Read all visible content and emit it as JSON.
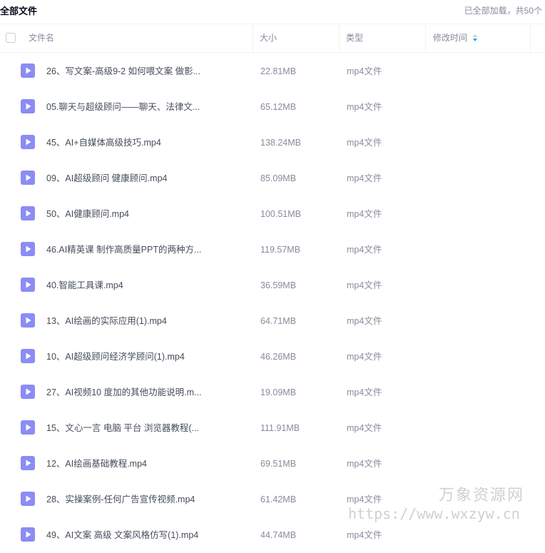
{
  "page": {
    "title": "全部文件",
    "status": "已全部加载，共50个"
  },
  "table": {
    "headers": {
      "name": "文件名",
      "size": "大小",
      "type": "类型",
      "mtime": "修改时间"
    },
    "rows": [
      {
        "name": "26、写文案-高级9-2 如何喂文案 做影...",
        "size": "22.81MB",
        "type": "mp4文件"
      },
      {
        "name": "05.聊天与超级顾问——聊天、法律文...",
        "size": "65.12MB",
        "type": "mp4文件"
      },
      {
        "name": "45、AI+自媒体高级技巧.mp4",
        "size": "138.24MB",
        "type": "mp4文件"
      },
      {
        "name": "09、AI超级顾问 健康顾问.mp4",
        "size": "85.09MB",
        "type": "mp4文件"
      },
      {
        "name": "50、AI健康顾问.mp4",
        "size": "100.51MB",
        "type": "mp4文件"
      },
      {
        "name": "46.AI精英课 制作高质量PPT的两种方...",
        "size": "119.57MB",
        "type": "mp4文件"
      },
      {
        "name": "40.智能工具课.mp4",
        "size": "36.59MB",
        "type": "mp4文件"
      },
      {
        "name": "13、AI绘画的实际应用(1).mp4",
        "size": "64.71MB",
        "type": "mp4文件"
      },
      {
        "name": "10、AI超级顾问经济学顾问(1).mp4",
        "size": "46.26MB",
        "type": "mp4文件"
      },
      {
        "name": "27、AI视频10 度加的其他功能说明.m...",
        "size": "19.09MB",
        "type": "mp4文件"
      },
      {
        "name": "15、文心一言 电脑 平台 浏览器教程(...",
        "size": "111.91MB",
        "type": "mp4文件"
      },
      {
        "name": "12、AI绘画基础教程.mp4",
        "size": "69.51MB",
        "type": "mp4文件"
      },
      {
        "name": "28、实操案例-任何广告宣传视频.mp4",
        "size": "61.42MB",
        "type": "mp4文件"
      },
      {
        "name": "49、AI文案 高级 文案风格仿写(1).mp4",
        "size": "44.74MB",
        "type": "mp4文件"
      }
    ]
  },
  "icons": {
    "row_icon": "video-file-icon",
    "sort_icon": "sort-icon"
  },
  "colors": {
    "icon_purple": "#8b8cf5",
    "sort_active": "#06a7ff",
    "muted_text": "#878c9c"
  },
  "watermark": {
    "line1": "万象资源网",
    "line2": "https://www.wxzyw.cn"
  }
}
